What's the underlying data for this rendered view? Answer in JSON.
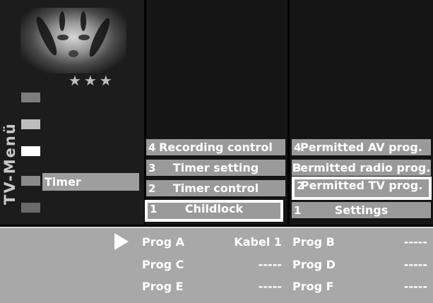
{
  "sidebar": {
    "vertical_title": "TV-Menü",
    "rating_stars": "★★★",
    "active_item": "Timer"
  },
  "middle_menu": [
    {
      "num": "4",
      "label": "Recording control"
    },
    {
      "num": "3",
      "label": "Timer setting"
    },
    {
      "num": "2",
      "label": "Timer control"
    },
    {
      "num": "1",
      "label": "Childlock",
      "selected": true
    }
  ],
  "right_menu": [
    {
      "num": "4",
      "label": "Permitted AV prog."
    },
    {
      "num": "3",
      "label": "Permitted radio prog."
    },
    {
      "num": "2",
      "label": "Permitted TV prog.",
      "selected": true
    },
    {
      "num": "1",
      "label": "Settings"
    }
  ],
  "programs": [
    {
      "name": "Prog A",
      "value": "Kabel 1"
    },
    {
      "name": "Prog B",
      "value": "-----"
    },
    {
      "name": "Prog C",
      "value": "-----"
    },
    {
      "name": "Prog D",
      "value": "-----"
    },
    {
      "name": "Prog E",
      "value": "-----"
    },
    {
      "name": "Prog F",
      "value": "-----"
    }
  ]
}
